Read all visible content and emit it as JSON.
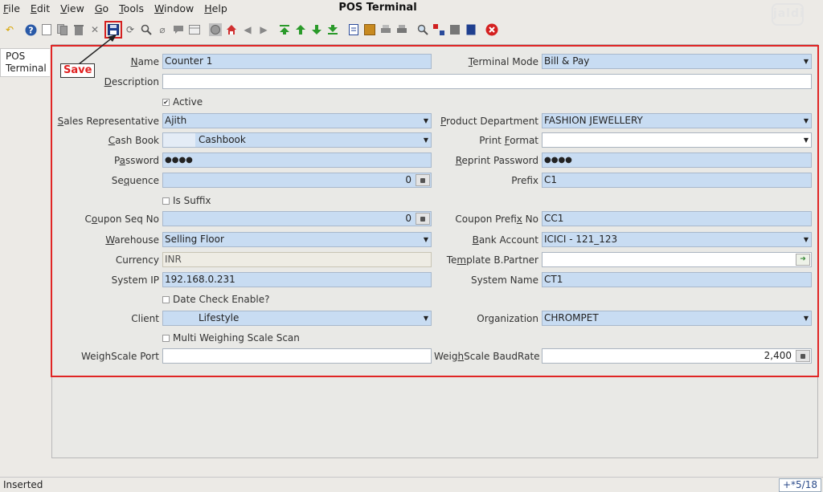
{
  "window": {
    "title": "POS Terminal",
    "logo_text": "jaldi"
  },
  "menu": [
    {
      "label": "File"
    },
    {
      "label": "Edit"
    },
    {
      "label": "View"
    },
    {
      "label": "Go"
    },
    {
      "label": "Tools"
    },
    {
      "label": "Window"
    },
    {
      "label": "Help"
    }
  ],
  "toolbar": {
    "save_callout": "Save"
  },
  "side_tab": {
    "label": "POS Terminal"
  },
  "form": {
    "name": {
      "label": "Name",
      "value": "Counter 1"
    },
    "terminal_mode": {
      "label": "Terminal Mode",
      "value": "Bill & Pay"
    },
    "description": {
      "label": "Description",
      "value": ""
    },
    "active": {
      "label": "Active",
      "checked": true
    },
    "sales_rep": {
      "label": "Sales Representative",
      "value": "Ajith"
    },
    "product_department": {
      "label": "Product Department",
      "value": "FASHION JEWELLERY"
    },
    "cash_book": {
      "label": "Cash Book",
      "value": "Cashbook"
    },
    "print_format": {
      "label": "Print Format",
      "value": ""
    },
    "password": {
      "label": "Password",
      "value": "●●●●"
    },
    "reprint_password": {
      "label": "Reprint Password",
      "value": "●●●●"
    },
    "sequence": {
      "label": "Sequence",
      "value": "0"
    },
    "prefix": {
      "label": "Prefix",
      "value": "C1"
    },
    "is_suffix": {
      "label": "Is Suffix",
      "checked": false
    },
    "coupon_seq_no": {
      "label": "Coupon Seq No",
      "value": "0"
    },
    "coupon_prefix_no": {
      "label": "Coupon Prefix No",
      "value": "CC1"
    },
    "warehouse": {
      "label": "Warehouse",
      "value": "Selling Floor"
    },
    "bank_account": {
      "label": "Bank Account",
      "value": "ICICI - 121_123"
    },
    "currency": {
      "label": "Currency",
      "value": "INR"
    },
    "template_bpartner": {
      "label": "Template B.Partner",
      "value": ""
    },
    "system_ip": {
      "label": "System IP",
      "value": "192.168.0.231"
    },
    "system_name": {
      "label": "System Name",
      "value": "CT1"
    },
    "date_check": {
      "label": "Date Check Enable?",
      "checked": false
    },
    "client": {
      "label": "Client",
      "value": "Lifestyle"
    },
    "organization": {
      "label": "Organization",
      "value": "CHROMPET"
    },
    "multi_weighing": {
      "label": "Multi Weighing Scale Scan",
      "checked": false
    },
    "weighscale_port": {
      "label": "WeighScale Port",
      "value": ""
    },
    "weighscale_baudrate": {
      "label": "WeighScale BaudRate",
      "value": "2,400"
    }
  },
  "status": {
    "message": "Inserted",
    "record_count": "+*5/18"
  }
}
